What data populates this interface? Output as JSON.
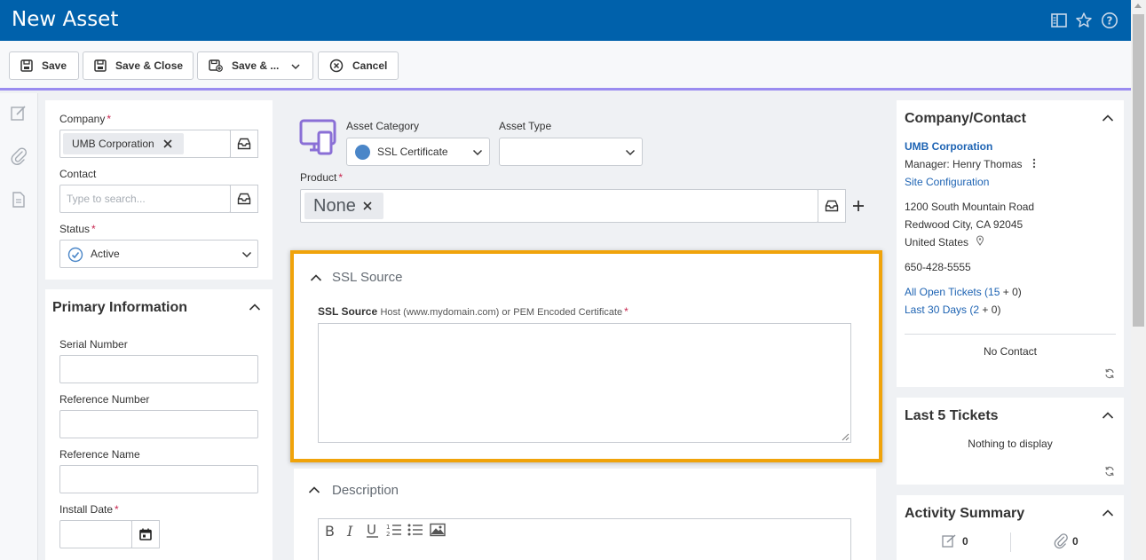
{
  "window": {
    "title": "New Asset"
  },
  "toolbar": {
    "save": "Save",
    "save_close": "Save & Close",
    "save_more": "Save & ...",
    "cancel": "Cancel"
  },
  "left": {
    "company_label": "Company",
    "company_value": "UMB Corporation",
    "contact_label": "Contact",
    "contact_placeholder": "Type to search...",
    "status_label": "Status",
    "status_value": "Active",
    "primary_title": "Primary Information",
    "serial_label": "Serial Number",
    "refnum_label": "Reference Number",
    "refname_label": "Reference Name",
    "install_label": "Install Date"
  },
  "middle": {
    "category_label": "Asset Category",
    "category_value": "SSL Certificate",
    "category_color": "#4a86c8",
    "type_label": "Asset Type",
    "product_label": "Product",
    "product_value": "None",
    "ssl_section_title": "SSL Source",
    "ssl_field_label": "SSL Source",
    "ssl_field_hint": "Host (www.mydomain.com) or PEM Encoded Certificate",
    "description_title": "Description",
    "highlight_color": "#f0a30a"
  },
  "right": {
    "cc_title": "Company/Contact",
    "company": "UMB Corporation",
    "manager": "Manager: Henry Thomas",
    "site_config": "Site Configuration",
    "address1": "1200 South Mountain Road",
    "address2": "Redwood City, CA 92045",
    "country": "United States",
    "phone": "650-428-5555",
    "open_tickets_label": "All Open Tickets",
    "open_tickets_count": "15",
    "open_tickets_plus": "0",
    "last30_label": "Last 30 Days",
    "last30_count": "2",
    "last30_plus": "0",
    "no_contact": "No Contact",
    "last5_title": "Last 5 Tickets",
    "nothing": "Nothing to display",
    "activity_title": "Activity Summary",
    "notes_count": "0",
    "attachments_count": "0"
  }
}
